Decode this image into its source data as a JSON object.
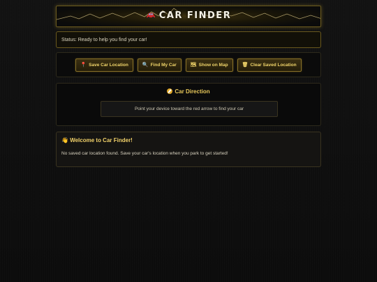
{
  "header": {
    "title": "CAR FINDER",
    "logo_icon": "car-icon"
  },
  "status": {
    "text": "Status: Ready to help you find your car!"
  },
  "toolbar": {
    "buttons": [
      {
        "label": "Save Car Location",
        "icon": "pin-icon",
        "glyph": "📍"
      },
      {
        "label": "Find My Car",
        "icon": "magnifier-icon",
        "glyph": "🔍"
      },
      {
        "label": "Show on Map",
        "icon": "map-icon",
        "glyph": "🗺"
      },
      {
        "label": "Clear Saved Location",
        "icon": "trash-icon",
        "glyph": "🗑"
      }
    ]
  },
  "direction": {
    "title": "Car Direction",
    "hint": "Point your device toward the red arrow to find your car"
  },
  "welcome": {
    "title": "Welcome to Car Finder!",
    "icon": "waving-hand-icon",
    "glyph": "👋",
    "message": "No saved car location found. Save your car's location when you park to get started!"
  },
  "colors": {
    "accent": "#e8c85a",
    "border": "#6b5a1e",
    "background": "#0f0f0f"
  }
}
